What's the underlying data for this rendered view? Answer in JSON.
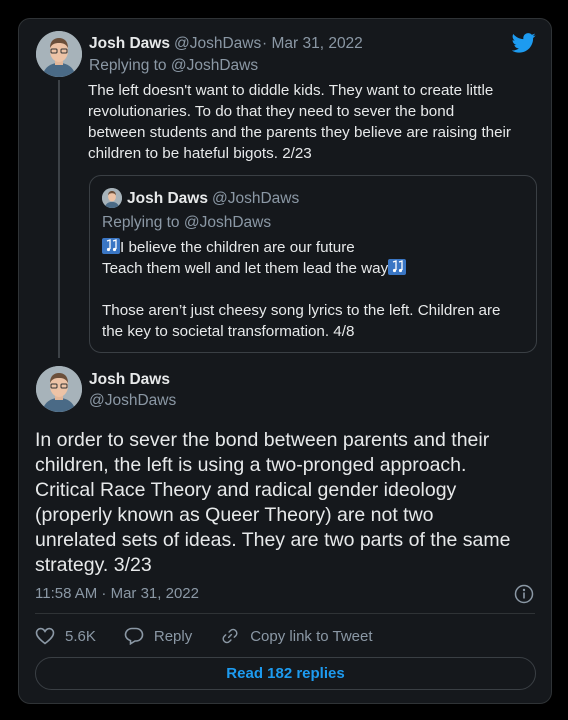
{
  "colors": {
    "background": "#000000",
    "card": "#15181c",
    "text": "#e7e9ea",
    "muted": "#8b98a5",
    "accent": "#1d9bf0",
    "border": "#2f3336"
  },
  "platform_icon": "twitter-bird-icon",
  "first_tweet": {
    "author_name": "Josh Daws",
    "author_handle": "@JoshDaws",
    "date_suffix": "· Mar 31, 2022",
    "replying_to": "Replying to @JoshDaws",
    "lines": [
      "The left doesn't want to diddle kids. They want to create little",
      "revolutionaries. To do that they need to sever the bond",
      "between students and the parents they believe are raising their",
      "children to be hateful bigots. 2/23"
    ]
  },
  "quoted_tweet": {
    "author_name": "Josh Daws",
    "author_handle": "@JoshDaws",
    "replying_to": "Replying to @JoshDaws",
    "line1": "I believe the children are our future",
    "line2": "Teach them well and let them lead the way",
    "line3": "Those aren’t just cheesy song lyrics to the left. Children are",
    "line4": "the key to societal transformation. 4/8"
  },
  "main_tweet": {
    "author_name": "Josh Daws",
    "author_handle": "@JoshDaws",
    "lines": [
      "In order to sever the bond between parents and their",
      "children, the left is using a two-pronged approach.",
      "Critical Race Theory and radical gender ideology",
      "(properly known as Queer Theory) are not two",
      "unrelated sets of ideas. They are two parts of the same",
      "strategy. 3/23"
    ],
    "timestamp": "11:58 AM · Mar 31, 2022"
  },
  "actions": {
    "like_count": "5.6K",
    "reply_label": "Reply",
    "copy_label": "Copy link to Tweet"
  },
  "read_replies_label": "Read 182 replies"
}
